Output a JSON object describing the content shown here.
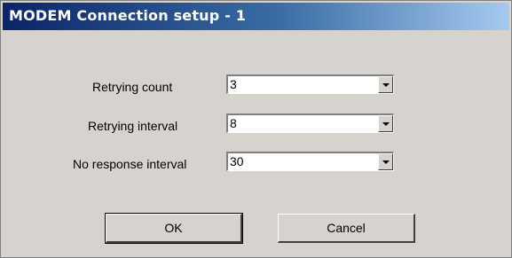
{
  "window": {
    "title": "MODEM Connection setup - 1"
  },
  "fields": [
    {
      "label": "Retrying count",
      "value": "3"
    },
    {
      "label": "Retrying interval",
      "value": "8"
    },
    {
      "label": "No response interval",
      "value": "30"
    }
  ],
  "buttons": {
    "ok": "OK",
    "cancel": "Cancel"
  },
  "icons": {
    "dropdown": "chevron-down-icon"
  },
  "colors": {
    "title_gradient_start": "#0a246a",
    "title_gradient_end": "#a6caf0",
    "dialog_background": "#d6d3ce"
  }
}
